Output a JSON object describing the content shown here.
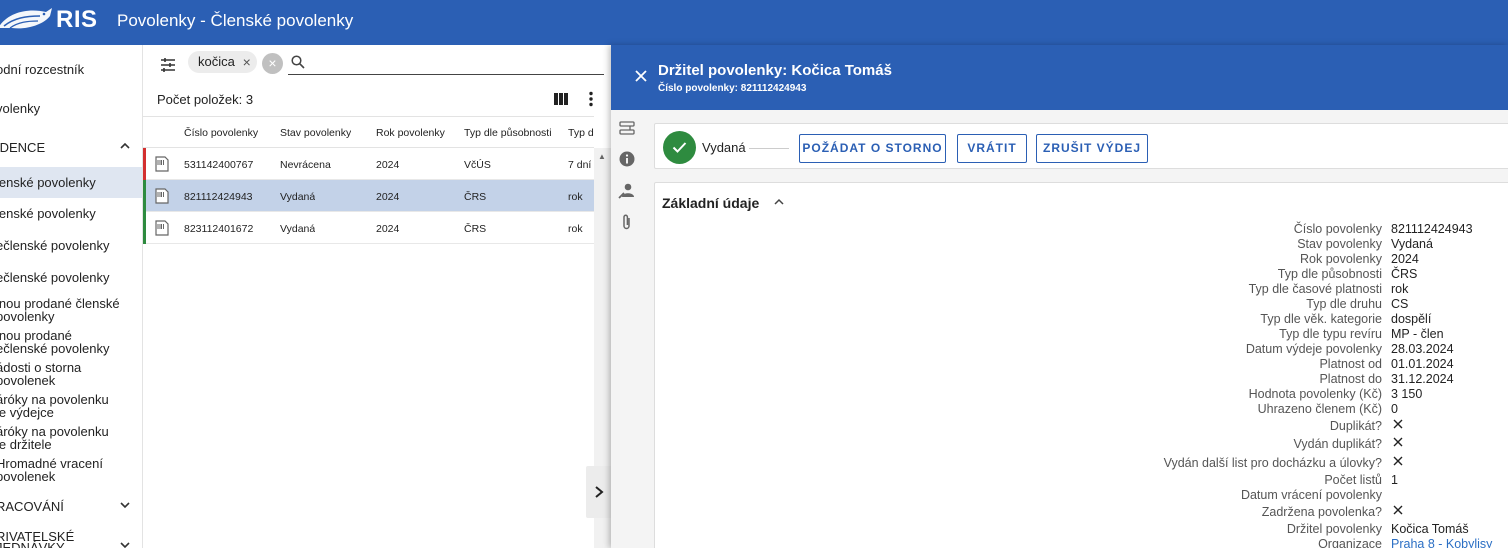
{
  "topbar": {
    "logo_text": "RIS",
    "title": "Povolenky - Členské povolenky"
  },
  "sidebar": {
    "items": [
      {
        "label": "odní rozcestník"
      },
      {
        "label": "volenky"
      },
      {
        "label": "IDENCE"
      },
      {
        "label": "lenské povolenky"
      },
      {
        "label": "lenské povolenky"
      },
      {
        "label": "ečlenské povolenky"
      },
      {
        "label": "ečlenské povolenky"
      },
      {
        "label": "lnou prodané členské\npovolenky"
      },
      {
        "label": "lnou prodané\nečlenské povolenky"
      },
      {
        "label": "ádosti o storna\npovolenek"
      },
      {
        "label": "áróky na povolenku\nle výdejce"
      },
      {
        "label": "áróky na povolenku\nle držitele"
      },
      {
        "label": "Hromadné vracení\npovolenek"
      },
      {
        "label": "RACOVÁNÍ"
      },
      {
        "label": "RIVATELSKÉ\nJEDNÁVKY"
      }
    ]
  },
  "list": {
    "filter_chip": "kočica",
    "search": {
      "value": "",
      "placeholder": ""
    },
    "count_label": "Počet položek: 3",
    "columns": [
      "Číslo povolenky",
      "Stav povolenky",
      "Rok povolenky",
      "Typ dle působnosti",
      "Typ dle č"
    ],
    "rows": [
      {
        "cislo": "531142400767",
        "stav": "Nevrácena",
        "rok": "2024",
        "typ": "VčÚS",
        "platnost": "7 dní",
        "status_color": "#d32f2f"
      },
      {
        "cislo": "821112424943",
        "stav": "Vydaná",
        "rok": "2024",
        "typ": "ČRS",
        "platnost": "rok",
        "status_color": "#2e8b3f"
      },
      {
        "cislo": "823112401672",
        "stav": "Vydaná",
        "rok": "2024",
        "typ": "ČRS",
        "platnost": "rok",
        "status_color": "#2e8b3f"
      }
    ]
  },
  "detail": {
    "title": "Držitel povolenky: Kočica Tomáš",
    "subtitle": "Číslo povolenky: 821112424943",
    "status_label": "Vydaná",
    "buttons": {
      "storno": "POŽÁDAT O STORNO",
      "vratit": "VRÁTIT",
      "zrusit": "ZRUŠIT VÝDEJ"
    },
    "section_title": "Základní údaje",
    "fields": [
      {
        "label": "Číslo povolenky",
        "value": "821112424943"
      },
      {
        "label": "Stav povolenky",
        "value": "Vydaná"
      },
      {
        "label": "Rok povolenky",
        "value": "2024"
      },
      {
        "label": "Typ dle působnosti",
        "value": "ČRS"
      },
      {
        "label": "Typ dle časové platnosti",
        "value": "rok"
      },
      {
        "label": "Typ dle druhu",
        "value": "CS"
      },
      {
        "label": "Typ dle věk. kategorie",
        "value": "dospělí"
      },
      {
        "label": "Typ dle typu revíru",
        "value": "MP - člen"
      },
      {
        "label": "Datum výdeje povolenky",
        "value": "28.03.2024"
      },
      {
        "label": "Platnost od",
        "value": "01.01.2024"
      },
      {
        "label": "Platnost do",
        "value": "31.12.2024"
      },
      {
        "label": "Hodnota povolenky (Kč)",
        "value": "3 150"
      },
      {
        "label": "Uhrazeno členem (Kč)",
        "value": "0"
      },
      {
        "label": "Duplikát?",
        "value": ""
      },
      {
        "label": "Vydán duplikát?",
        "value": ""
      },
      {
        "label": "Vydán další list pro docházku a úlovky?",
        "value": ""
      },
      {
        "label": "Počet listů",
        "value": "1"
      },
      {
        "label": "Datum vrácení povolenky",
        "value": ""
      },
      {
        "label": "Zadržena povolenka?",
        "value": ""
      },
      {
        "label": "Držitel povolenky",
        "value": "Kočica Tomáš"
      },
      {
        "label": "Organizace",
        "value": "Praha 8 - Kobylisy"
      }
    ]
  }
}
